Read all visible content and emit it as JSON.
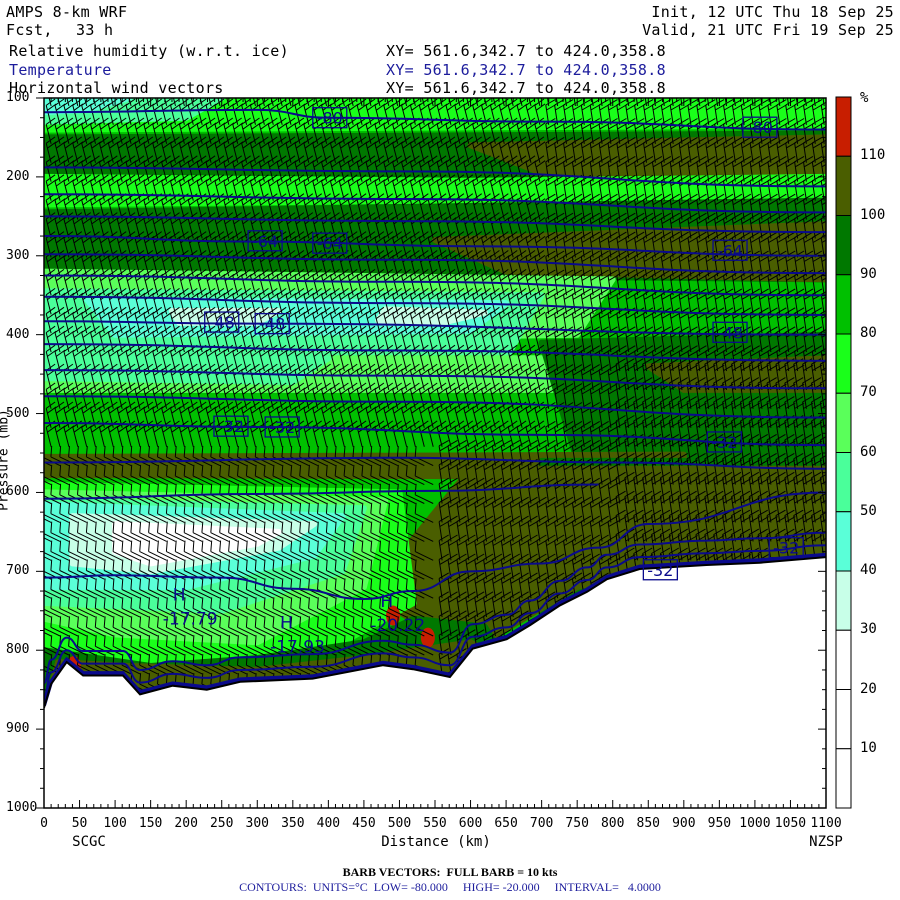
{
  "header": {
    "model": "AMPS 8-km WRF",
    "init": "Init, 12 UTC Thu 18 Sep 25",
    "fcst_label": "Fcst,",
    "fcst_value": "33 h",
    "valid": "Valid, 21 UTC Fri 19 Sep 25",
    "fields": [
      {
        "name": "Relative humidity (w.r.t. ice)",
        "xy": "XY= 561.6,342.7 to 424.0,358.8"
      },
      {
        "name": "Temperature",
        "xy": "XY= 561.6,342.7 to 424.0,358.8"
      },
      {
        "name": "Horizontal wind vectors",
        "xy": "XY= 561.6,342.7 to 424.0,358.8"
      }
    ]
  },
  "footer": {
    "barb": "BARB VECTORS:  FULL BARB = 10 kts",
    "contours": "CONTOURS:  UNITS=°C  LOW= -80.000     HIGH= -20.000     INTERVAL=   4.0000"
  },
  "colors": {
    "contour": "#0a0a8c",
    "rh_bins": [
      "#ffffff",
      "#ffffff",
      "#ffffff",
      "#c8ffe8",
      "#5affd8",
      "#4aff9a",
      "#5aff5a",
      "#1aff1a",
      "#00c000",
      "#007800",
      "#4a5e00",
      "#c81e00"
    ]
  },
  "chart_data": {
    "type": "heatmap",
    "title": "Relative humidity (w.r.t. ice), Temperature, Horizontal wind vectors",
    "xlabel": "Distance (km)",
    "ylabel": "Pressure (mb)",
    "xlim": [
      0,
      1100
    ],
    "ylim": [
      1000,
      100
    ],
    "x_ticks": [
      "0",
      "50",
      "100",
      "150",
      "200",
      "250",
      "300",
      "350",
      "400",
      "450",
      "500",
      "550",
      "600",
      "650",
      "700",
      "750",
      "800",
      "850",
      "900",
      "950",
      "1000",
      "1050",
      "1100"
    ],
    "y_ticks": [
      "100",
      "200",
      "300",
      "400",
      "500",
      "600",
      "700",
      "800",
      "900",
      "1000"
    ],
    "endpoints": {
      "left": "SCGC",
      "right": "NZSP"
    },
    "colorbar": {
      "unit": "%",
      "labels": [
        "110",
        "100",
        "90",
        "80",
        "70",
        "60",
        "50",
        "40",
        "30",
        "20",
        "10"
      ],
      "range": [
        0,
        120
      ],
      "interval": 10
    },
    "rh_regions": [
      {
        "rh": 75,
        "poly": [
          [
            0,
            100
          ],
          [
            1100,
            100
          ],
          [
            1100,
            135
          ],
          [
            0,
            140
          ]
        ]
      },
      {
        "rh": 55,
        "poly": [
          [
            0,
            100
          ],
          [
            250,
            100
          ],
          [
            200,
            125
          ],
          [
            0,
            130
          ]
        ]
      },
      {
        "rh": 45,
        "poly": [
          [
            0,
            100
          ],
          [
            120,
            100
          ],
          [
            60,
            115
          ],
          [
            0,
            118
          ]
        ]
      },
      {
        "rh": 95,
        "poly": [
          [
            0,
            150
          ],
          [
            1100,
            145
          ],
          [
            1100,
            200
          ],
          [
            0,
            195
          ]
        ]
      },
      {
        "rh": 105,
        "poly": [
          [
            600,
            160
          ],
          [
            1100,
            150
          ],
          [
            1100,
            200
          ],
          [
            700,
            195
          ]
        ]
      },
      {
        "rh": 75,
        "poly": [
          [
            0,
            200
          ],
          [
            600,
            205
          ],
          [
            1100,
            200
          ],
          [
            1100,
            225
          ],
          [
            0,
            235
          ]
        ]
      },
      {
        "rh": 95,
        "poly": [
          [
            0,
            245
          ],
          [
            1100,
            230
          ],
          [
            1100,
            330
          ],
          [
            0,
            320
          ]
        ]
      },
      {
        "rh": 105,
        "poly": [
          [
            550,
            280
          ],
          [
            1100,
            260
          ],
          [
            1100,
            330
          ],
          [
            650,
            320
          ]
        ]
      },
      {
        "rh": 65,
        "poly": [
          [
            0,
            320
          ],
          [
            800,
            330
          ],
          [
            750,
            400
          ],
          [
            0,
            410
          ]
        ]
      },
      {
        "rh": 55,
        "poly": [
          [
            0,
            345
          ],
          [
            700,
            350
          ],
          [
            650,
            430
          ],
          [
            0,
            420
          ]
        ]
      },
      {
        "rh": 45,
        "poly": [
          [
            60,
            355
          ],
          [
            650,
            360
          ],
          [
            600,
            395
          ],
          [
            100,
            400
          ]
        ]
      },
      {
        "rh": 35,
        "poly": [
          [
            180,
            370
          ],
          [
            330,
            370
          ],
          [
            300,
            385
          ],
          [
            190,
            385
          ]
        ]
      },
      {
        "rh": 35,
        "poly": [
          [
            480,
            368
          ],
          [
            620,
            372
          ],
          [
            560,
            385
          ],
          [
            470,
            382
          ]
        ]
      },
      {
        "rh": 65,
        "poly": [
          [
            0,
            430
          ],
          [
            800,
            430
          ],
          [
            800,
            470
          ],
          [
            0,
            470
          ]
        ]
      },
      {
        "rh": 55,
        "poly": [
          [
            0,
            420
          ],
          [
            400,
            430
          ],
          [
            350,
            460
          ],
          [
            0,
            455
          ]
        ]
      },
      {
        "rh": 95,
        "poly": [
          [
            700,
            410
          ],
          [
            1100,
            400
          ],
          [
            1100,
            560
          ],
          [
            750,
            560
          ]
        ]
      },
      {
        "rh": 105,
        "poly": [
          [
            850,
            440
          ],
          [
            1100,
            430
          ],
          [
            1100,
            470
          ],
          [
            900,
            470
          ]
        ]
      },
      {
        "rh": 105,
        "poly": [
          [
            0,
            555
          ],
          [
            900,
            552
          ],
          [
            900,
            580
          ],
          [
            0,
            578
          ]
        ]
      },
      {
        "rh": 95,
        "poly": [
          [
            700,
            560
          ],
          [
            1100,
            560
          ],
          [
            1100,
            680
          ],
          [
            700,
            760
          ]
        ]
      },
      {
        "rh": 105,
        "poly": [
          [
            600,
            570
          ],
          [
            1100,
            570
          ],
          [
            1100,
            679
          ],
          [
            850,
            695
          ],
          [
            750,
            720
          ],
          [
            600,
            800
          ],
          [
            550,
            780
          ],
          [
            480,
            740
          ],
          [
            500,
            680
          ]
        ]
      },
      {
        "rh": 75,
        "poly": [
          [
            0,
            590
          ],
          [
            500,
            600
          ],
          [
            520,
            740
          ],
          [
            400,
            800
          ],
          [
            200,
            820
          ],
          [
            0,
            800
          ]
        ]
      },
      {
        "rh": 65,
        "poly": [
          [
            0,
            600
          ],
          [
            480,
            610
          ],
          [
            450,
            720
          ],
          [
            300,
            790
          ],
          [
            100,
            780
          ],
          [
            0,
            760
          ]
        ]
      },
      {
        "rh": 55,
        "poly": [
          [
            0,
            610
          ],
          [
            450,
            620
          ],
          [
            420,
            700
          ],
          [
            250,
            750
          ],
          [
            0,
            740
          ]
        ]
      },
      {
        "rh": 45,
        "poly": [
          [
            0,
            615
          ],
          [
            420,
            630
          ],
          [
            380,
            680
          ],
          [
            200,
            720
          ],
          [
            0,
            720
          ]
        ]
      },
      {
        "rh": 35,
        "poly": [
          [
            40,
            630
          ],
          [
            380,
            640
          ],
          [
            330,
            670
          ],
          [
            150,
            700
          ],
          [
            40,
            690
          ]
        ]
      },
      {
        "rh": 25,
        "poly": [
          [
            100,
            640
          ],
          [
            330,
            650
          ],
          [
            300,
            665
          ],
          [
            150,
            690
          ],
          [
            100,
            675
          ]
        ]
      },
      {
        "rh": 95,
        "poly": [
          [
            0,
            800
          ],
          [
            150,
            820
          ],
          [
            300,
            810
          ],
          [
            450,
            790
          ],
          [
            520,
            760
          ],
          [
            620,
            770
          ],
          [
            640,
            800
          ],
          [
            540,
            840
          ],
          [
            0,
            880
          ]
        ]
      },
      {
        "rh": 105,
        "poly": [
          [
            20,
            815
          ],
          [
            120,
            820
          ],
          [
            300,
            825
          ],
          [
            450,
            810
          ],
          [
            600,
            790
          ],
          [
            620,
            800
          ],
          [
            540,
            840
          ],
          [
            0,
            880
          ]
        ]
      }
    ],
    "rh_maxima": [
      {
        "rh": 115,
        "km": 491,
        "mb": 756
      },
      {
        "rh": 115,
        "km": 540,
        "mb": 784
      },
      {
        "rh": 115,
        "km": 42,
        "mb": 820
      }
    ],
    "surface": [
      [
        0,
        870
      ],
      [
        10,
        840
      ],
      [
        32,
        812
      ],
      [
        55,
        829
      ],
      [
        111,
        829
      ],
      [
        135,
        853
      ],
      [
        181,
        842
      ],
      [
        229,
        847
      ],
      [
        276,
        837
      ],
      [
        378,
        833
      ],
      [
        477,
        816
      ],
      [
        519,
        821
      ],
      [
        571,
        831
      ],
      [
        603,
        795
      ],
      [
        651,
        783
      ],
      [
        684,
        765
      ],
      [
        726,
        740
      ],
      [
        764,
        723
      ],
      [
        792,
        707
      ],
      [
        838,
        694
      ],
      [
        932,
        689
      ],
      [
        1007,
        686
      ],
      [
        1100,
        679
      ]
    ],
    "isotherms": [
      {
        "t": -80,
        "pts": [
          [
            0,
            118
          ],
          [
            300,
            115
          ],
          [
            400,
            125
          ],
          [
            700,
            130
          ],
          [
            1100,
            140
          ]
        ]
      },
      {
        "t": -76,
        "pts": [
          [
            0,
            188
          ],
          [
            500,
            193
          ],
          [
            1100,
            212
          ]
        ]
      },
      {
        "t": -72,
        "pts": [
          [
            0,
            222
          ],
          [
            500,
            228
          ],
          [
            1100,
            245
          ]
        ]
      },
      {
        "t": -68,
        "pts": [
          [
            0,
            250
          ],
          [
            500,
            256
          ],
          [
            1100,
            270
          ]
        ]
      },
      {
        "t": -64,
        "pts": [
          [
            0,
            275
          ],
          [
            300,
            282
          ],
          [
            600,
            288
          ],
          [
            1100,
            300
          ]
        ]
      },
      {
        "t": -60,
        "pts": [
          [
            0,
            298
          ],
          [
            500,
            305
          ],
          [
            1100,
            322
          ]
        ]
      },
      {
        "t": -56,
        "pts": [
          [
            0,
            325
          ],
          [
            500,
            333
          ],
          [
            1100,
            350
          ]
        ]
      },
      {
        "t": -52,
        "pts": [
          [
            0,
            352
          ],
          [
            500,
            360
          ],
          [
            1100,
            375
          ]
        ]
      },
      {
        "t": -48,
        "pts": [
          [
            0,
            383
          ],
          [
            300,
            386
          ],
          [
            1100,
            400
          ]
        ]
      },
      {
        "t": -44,
        "pts": [
          [
            0,
            412
          ],
          [
            500,
            420
          ],
          [
            1100,
            433
          ]
        ]
      },
      {
        "t": -40,
        "pts": [
          [
            0,
            445
          ],
          [
            500,
            452
          ],
          [
            1100,
            468
          ]
        ]
      },
      {
        "t": -36,
        "pts": [
          [
            0,
            478
          ],
          [
            500,
            485
          ],
          [
            1100,
            505
          ]
        ]
      },
      {
        "t": -32,
        "pts": [
          [
            0,
            512
          ],
          [
            300,
            517
          ],
          [
            700,
            527
          ],
          [
            1100,
            540
          ]
        ]
      },
      {
        "t": -28,
        "pts": [
          [
            0,
            562
          ],
          [
            500,
            556
          ],
          [
            800,
            562
          ],
          [
            1100,
            570
          ]
        ]
      },
      {
        "t": -24,
        "pts": [
          [
            0,
            608
          ],
          [
            300,
            602
          ],
          [
            550,
            598
          ],
          [
            780,
            590
          ]
        ]
      },
      {
        "t": -20,
        "pts": [
          [
            0,
            708
          ],
          [
            100,
            705
          ],
          [
            250,
            708
          ],
          [
            350,
            722
          ],
          [
            450,
            735
          ],
          [
            520,
            725
          ],
          [
            600,
            700
          ],
          [
            700,
            690
          ],
          [
            780,
            670
          ],
          [
            850,
            640
          ],
          [
            1100,
            600
          ]
        ]
      }
    ],
    "contour_labels": [
      {
        "text": "-80",
        "km": 402,
        "mb": 125
      },
      {
        "text": "-80",
        "km": 1007,
        "mb": 137
      },
      {
        "text": "-64",
        "km": 311,
        "mb": 281
      },
      {
        "text": "-64",
        "km": 402,
        "mb": 284
      },
      {
        "text": "-64",
        "km": 965,
        "mb": 293
      },
      {
        "text": "-48",
        "km": 250,
        "mb": 384
      },
      {
        "text": "-48",
        "km": 321,
        "mb": 386
      },
      {
        "text": "-48",
        "km": 965,
        "mb": 397
      },
      {
        "text": "-32",
        "km": 263,
        "mb": 516
      },
      {
        "text": "-32",
        "km": 335,
        "mb": 517
      },
      {
        "text": "-32",
        "km": 957,
        "mb": 536
      },
      {
        "text": "-32",
        "km": 867,
        "mb": 698
      },
      {
        "text": "-32",
        "km": 1044,
        "mb": 670
      }
    ],
    "extrema": [
      {
        "label": "H",
        "value": "-17.79",
        "km": 198,
        "mb": 755
      },
      {
        "label": "H",
        "value": "-17.93",
        "km": 349,
        "mb": 790
      },
      {
        "label": "H",
        "value": "-20.22",
        "km": 490,
        "mb": 763
      }
    ]
  }
}
